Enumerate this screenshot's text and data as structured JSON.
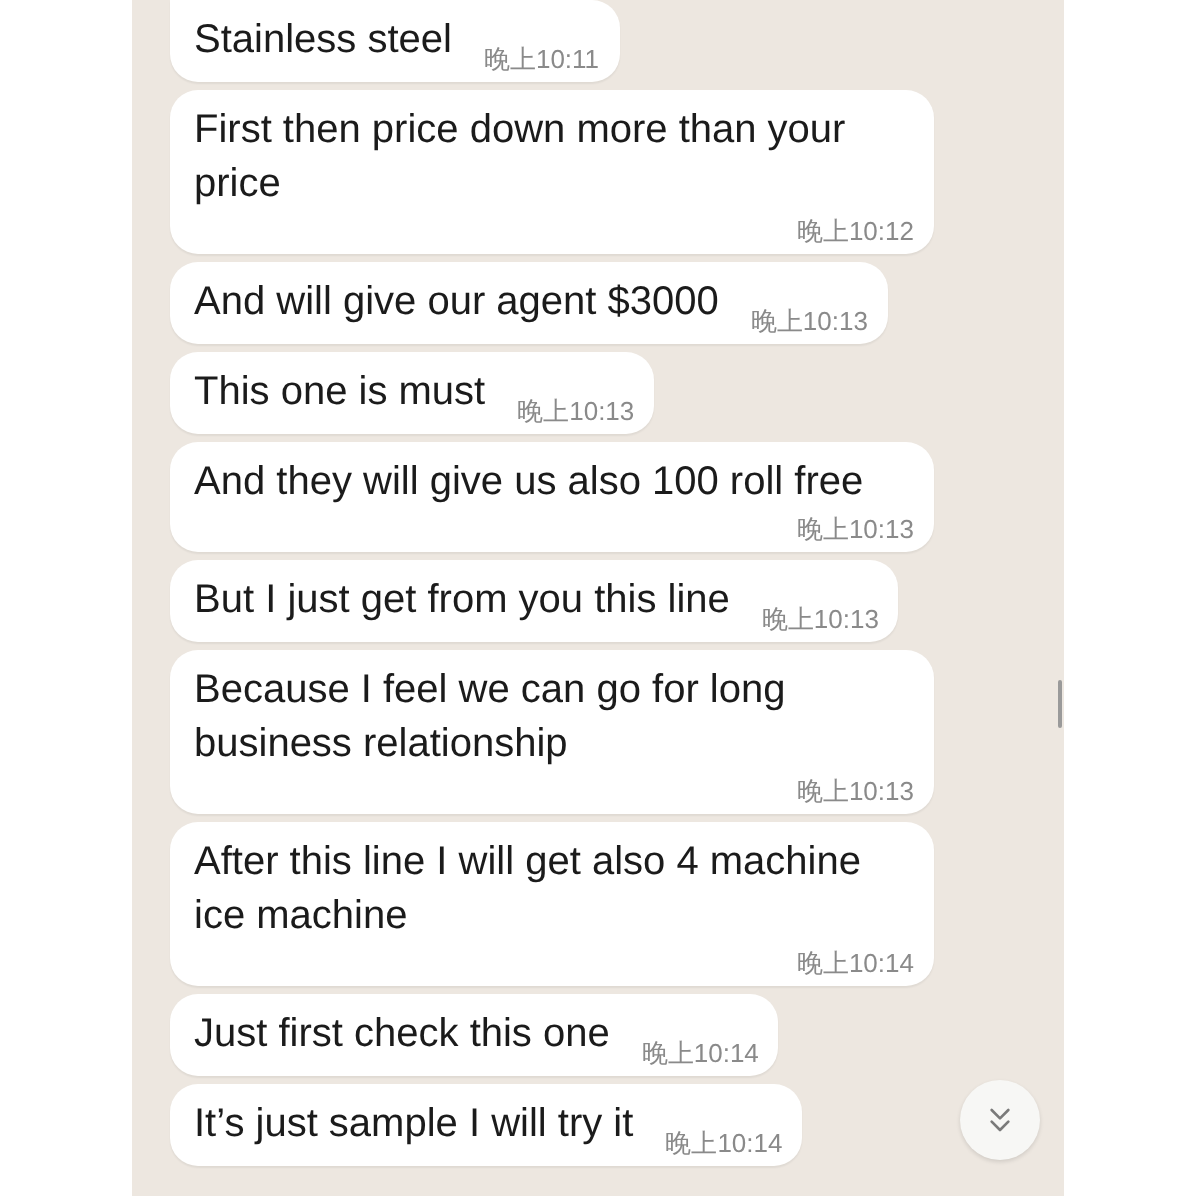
{
  "messages": [
    {
      "text": "Stainless steel",
      "time": "晚上10:11"
    },
    {
      "text": "First then price down more than your price",
      "time": "晚上10:12"
    },
    {
      "text": "And will give our agent $3000",
      "time": "晚上10:13"
    },
    {
      "text": "This one is must",
      "time": "晚上10:13"
    },
    {
      "text": "And they will give us also 100 roll free",
      "time": "晚上10:13"
    },
    {
      "text": "But I just get from you this line",
      "time": "晚上10:13"
    },
    {
      "text": "Because I feel we can go for long business relationship",
      "time": "晚上10:13"
    },
    {
      "text": "After this line I will get also 4 machine ice machine",
      "time": "晚上10:14"
    },
    {
      "text": "Just first check this one",
      "time": "晚上10:14"
    },
    {
      "text": "It’s just sample I will try it",
      "time": "晚上10:14"
    }
  ]
}
